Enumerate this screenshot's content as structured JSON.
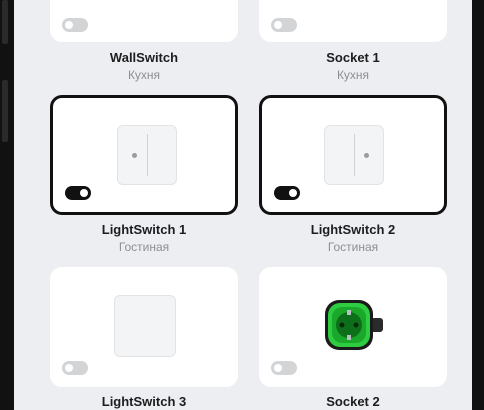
{
  "devices": [
    {
      "name": "WallSwitch",
      "room": "Кухня",
      "toggle_on": false,
      "selected": false,
      "icon": "wall-switch-icon"
    },
    {
      "name": "Socket 1",
      "room": "Кухня",
      "toggle_on": false,
      "selected": false,
      "icon": "socket-icon"
    },
    {
      "name": "LightSwitch 1",
      "room": "Гостиная",
      "toggle_on": true,
      "selected": true,
      "icon": "light-switch-icon"
    },
    {
      "name": "LightSwitch 2",
      "room": "Гостиная",
      "toggle_on": true,
      "selected": true,
      "icon": "light-switch-icon"
    },
    {
      "name": "LightSwitch 3",
      "room": "",
      "toggle_on": false,
      "selected": false,
      "icon": "light-switch-icon"
    },
    {
      "name": "Socket 2",
      "room": "",
      "toggle_on": false,
      "selected": false,
      "icon": "socket-icon"
    }
  ],
  "colors": {
    "background": "#eceef1",
    "card": "#ffffff",
    "selected_border": "#111111",
    "socket_accent": "#2ecc40",
    "room_text": "#8e8e93"
  }
}
